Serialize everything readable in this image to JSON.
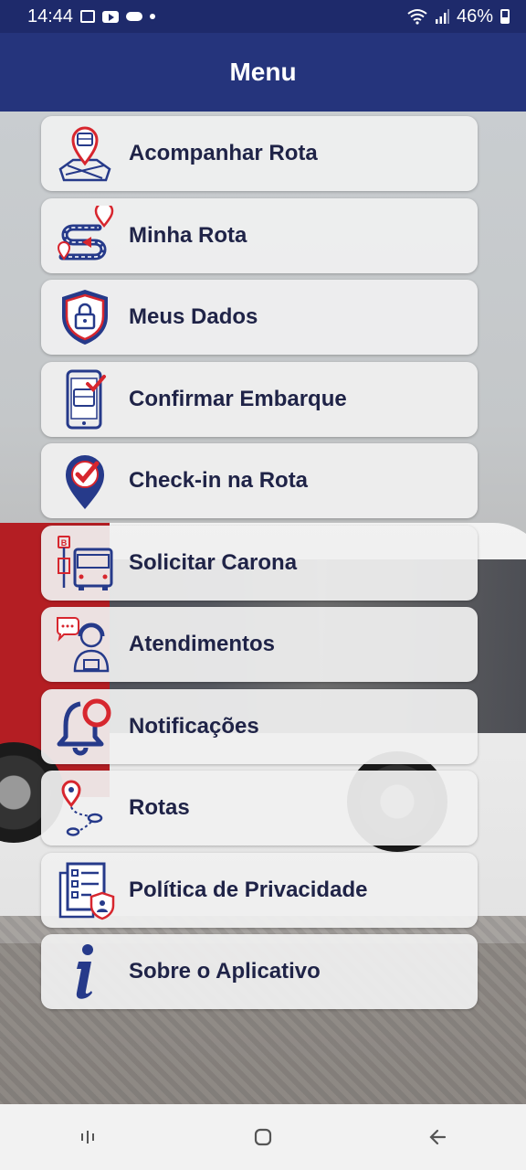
{
  "status_bar": {
    "time": "14:44",
    "battery": "46%",
    "icons": [
      "image-icon",
      "youtube-icon",
      "cloud-icon",
      "dot-icon",
      "wifi-icon",
      "signal-icon",
      "battery-icon"
    ]
  },
  "header": {
    "title": "Menu"
  },
  "menu": {
    "items": [
      {
        "label": "Acompanhar Rota",
        "icon": "bus-map-pin-icon"
      },
      {
        "label": "Minha Rota",
        "icon": "route-path-icon"
      },
      {
        "label": "Meus Dados",
        "icon": "shield-lock-icon"
      },
      {
        "label": "Confirmar Embarque",
        "icon": "phone-bus-check-icon"
      },
      {
        "label": "Check-in na Rota",
        "icon": "map-pin-check-icon"
      },
      {
        "label": "Solicitar Carona",
        "icon": "bus-stop-icon"
      },
      {
        "label": "Atendimentos",
        "icon": "support-agent-icon"
      },
      {
        "label": "Notificações",
        "icon": "bell-icon"
      },
      {
        "label": "Rotas",
        "icon": "routes-icon"
      },
      {
        "label": "Política de Privacidade",
        "icon": "privacy-document-icon"
      },
      {
        "label": "Sobre o Aplicativo",
        "icon": "info-icon"
      }
    ]
  },
  "nav_bar": {
    "icons": [
      "recent-apps-icon",
      "home-icon",
      "back-icon"
    ]
  },
  "colors": {
    "primary": "#25347c",
    "accent_red": "#d7262e",
    "icon_blue": "#263a8a"
  }
}
